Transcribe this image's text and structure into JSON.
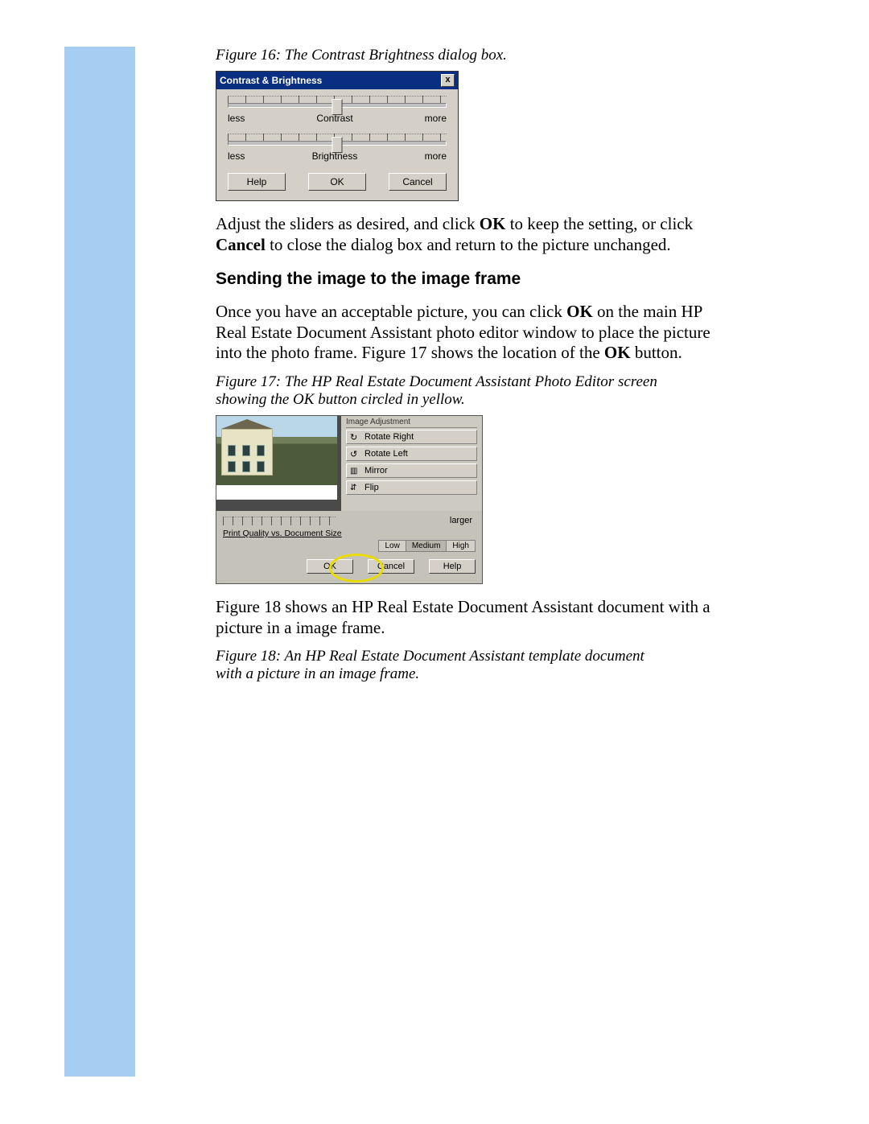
{
  "captions": {
    "fig16": "Figure 16: The Contrast Brightness dialog box.",
    "fig17": "Figure 17: The HP Real Estate Document Assistant Photo Editor screen showing the OK button circled in yellow.",
    "fig18": "Figure 18: An HP Real Estate Document Assistant template document with a picture in an image frame."
  },
  "paragraphs": {
    "p1a": "Adjust the sliders as desired, and click ",
    "p1b": " to keep the setting, or click ",
    "p1c": " to close the dialog box and return to the picture unchanged.",
    "p2a": "Once you have an acceptable picture, you can click ",
    "p2b": " on the main HP Real Estate Document Assistant photo editor window to place the picture into the photo frame. Figure 17 shows the location of the ",
    "p2c": " button.",
    "p3": "Figure 18 shows an HP Real Estate Document Assistant document with a picture in a image frame."
  },
  "bold": {
    "ok": "OK",
    "cancel": "Cancel"
  },
  "heading": "Sending the image to the image frame",
  "dialog16": {
    "title": "Contrast & Brightness",
    "close": "x",
    "slider1": {
      "left": "less",
      "mid": "Contrast",
      "right": "more"
    },
    "slider2": {
      "left": "less",
      "mid": "Brightness",
      "right": "more"
    },
    "buttons": {
      "help": "Help",
      "ok": "OK",
      "cancel": "Cancel"
    }
  },
  "fig17panel": {
    "panel_head": "Image Adjustment",
    "tools": {
      "rotate_right": "Rotate Right",
      "rotate_left": "Rotate Left",
      "mirror": "Mirror",
      "flip": "Flip"
    },
    "larger": "larger",
    "quality_label": "Print Quality vs. Document Size",
    "quality_opts": {
      "low": "Low",
      "medium": "Medium",
      "high": "High"
    },
    "buttons": {
      "ok": "OK",
      "cancel": "Cancel",
      "help": "Help"
    }
  }
}
